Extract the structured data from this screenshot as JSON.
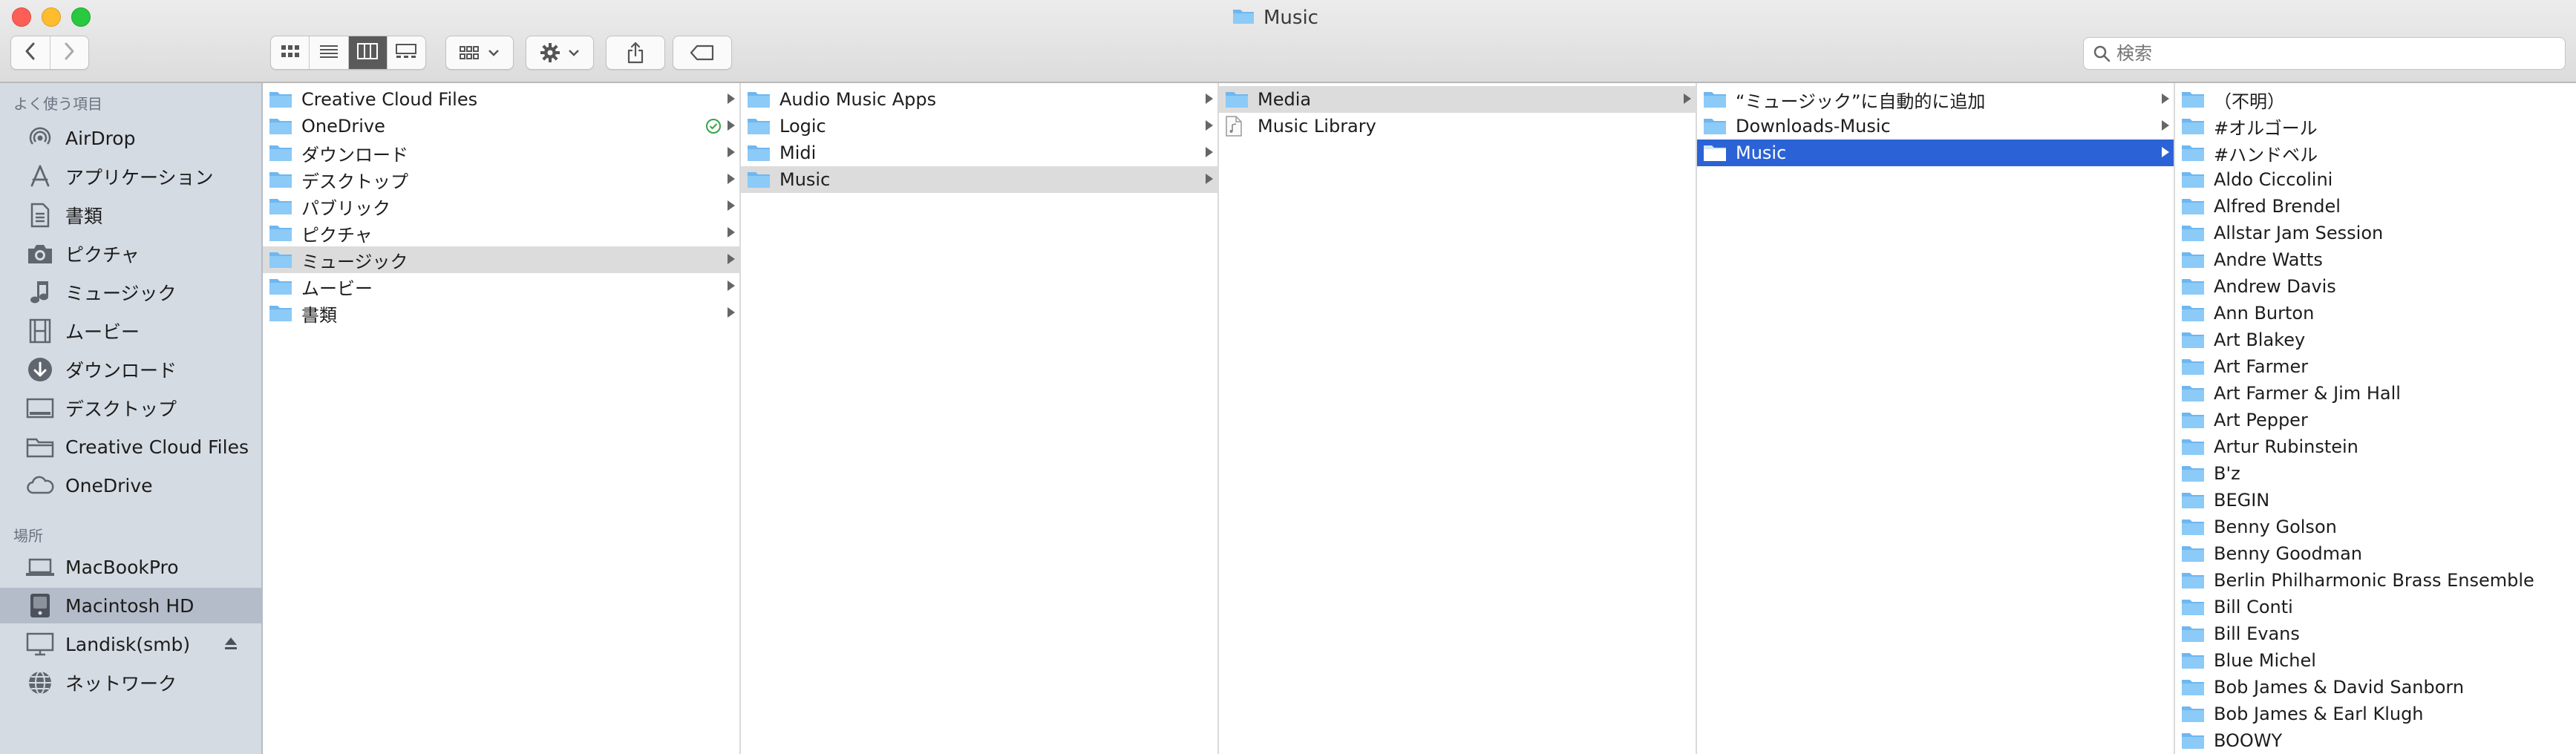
{
  "window": {
    "title": "Music"
  },
  "toolbar": {
    "back_icon": "chevron-left-icon",
    "forward_icon": "chevron-right-icon",
    "view_modes": [
      "icon-view",
      "list-view",
      "column-view",
      "gallery-view"
    ],
    "active_view": "column-view",
    "search_placeholder": "検索"
  },
  "sidebar": {
    "favorites_header": "よく使う項目",
    "favorites": [
      {
        "label": "AirDrop",
        "icon": "airdrop-icon"
      },
      {
        "label": "アプリケーション",
        "icon": "applications-icon"
      },
      {
        "label": "書類",
        "icon": "documents-icon"
      },
      {
        "label": "ピクチャ",
        "icon": "camera-icon"
      },
      {
        "label": "ミュージック",
        "icon": "music-note-icon"
      },
      {
        "label": "ムービー",
        "icon": "film-icon"
      },
      {
        "label": "ダウンロード",
        "icon": "download-icon"
      },
      {
        "label": "デスクトップ",
        "icon": "desktop-icon"
      },
      {
        "label": "Creative Cloud Files",
        "icon": "folder-icon"
      },
      {
        "label": "OneDrive",
        "icon": "cloud-icon"
      }
    ],
    "locations_header": "場所",
    "locations": [
      {
        "label": "MacBookPro",
        "icon": "laptop-icon",
        "selected": false
      },
      {
        "label": "Macintosh HD",
        "icon": "hard-drive-icon",
        "selected": true
      },
      {
        "label": "Landisk(smb)",
        "icon": "network-display-icon",
        "selected": false
      },
      {
        "label": "ネットワーク",
        "icon": "globe-icon",
        "selected": false
      }
    ]
  },
  "columns": [
    {
      "items": [
        {
          "label": "Creative Cloud Files",
          "arrow": true
        },
        {
          "label": "OneDrive",
          "arrow": true,
          "sync": true
        },
        {
          "label": "ダウンロード",
          "arrow": true
        },
        {
          "label": "デスクトップ",
          "arrow": true
        },
        {
          "label": "パブリック",
          "arrow": true
        },
        {
          "label": "ピクチャ",
          "arrow": true
        },
        {
          "label": "ミュージック",
          "arrow": true,
          "state": "gray"
        },
        {
          "label": "ムービー",
          "arrow": true
        },
        {
          "label": "書類",
          "arrow": true
        }
      ]
    },
    {
      "items": [
        {
          "label": "Audio Music Apps",
          "arrow": true
        },
        {
          "label": "Logic",
          "arrow": true
        },
        {
          "label": "Midi",
          "arrow": true
        },
        {
          "label": "Music",
          "arrow": true,
          "state": "gray"
        }
      ]
    },
    {
      "items": [
        {
          "label": "Media",
          "arrow": true,
          "state": "gray"
        },
        {
          "label": "Music Library",
          "arrow": false,
          "kind": "file"
        }
      ]
    },
    {
      "items": [
        {
          "label": "“ミュージック”に自動的に追加",
          "arrow": true
        },
        {
          "label": "Downloads-Music",
          "arrow": true
        },
        {
          "label": "Music",
          "arrow": true,
          "state": "blue"
        }
      ]
    },
    {
      "items": [
        {
          "label": "（不明）"
        },
        {
          "label": "#オルゴール"
        },
        {
          "label": "#ハンドベル"
        },
        {
          "label": "Aldo Ciccolini"
        },
        {
          "label": "Alfred Brendel"
        },
        {
          "label": "Allstar Jam Session"
        },
        {
          "label": "Andre Watts"
        },
        {
          "label": "Andrew Davis"
        },
        {
          "label": "Ann Burton"
        },
        {
          "label": "Art Blakey"
        },
        {
          "label": "Art Farmer"
        },
        {
          "label": "Art Farmer & Jim Hall"
        },
        {
          "label": "Art Pepper"
        },
        {
          "label": "Artur Rubinstein"
        },
        {
          "label": "B'z"
        },
        {
          "label": "BEGIN"
        },
        {
          "label": "Benny Golson"
        },
        {
          "label": "Benny Goodman"
        },
        {
          "label": "Berlin Philharmonic Brass Ensemble"
        },
        {
          "label": "Bill Conti"
        },
        {
          "label": "Bill Evans"
        },
        {
          "label": "Blue Michel"
        },
        {
          "label": "Bob James & David Sanborn"
        },
        {
          "label": "Bob James & Earl Klugh"
        },
        {
          "label": "BOOWY"
        }
      ]
    }
  ]
}
